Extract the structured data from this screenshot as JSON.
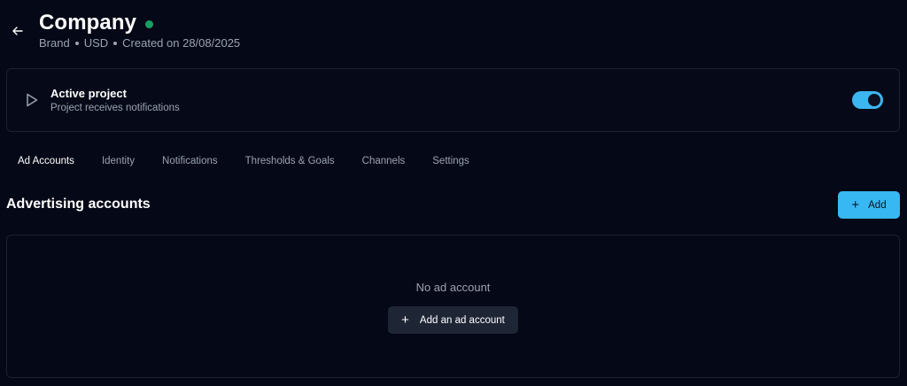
{
  "header": {
    "title": "Company",
    "meta": {
      "type": "Brand",
      "currency": "USD",
      "created": "Created on 28/08/2025"
    }
  },
  "project": {
    "title": "Active project",
    "subtitle": "Project receives notifications",
    "toggle_on": true
  },
  "tabs": [
    {
      "label": "Ad Accounts",
      "active": true
    },
    {
      "label": "Identity",
      "active": false
    },
    {
      "label": "Notifications",
      "active": false
    },
    {
      "label": "Thresholds & Goals",
      "active": false
    },
    {
      "label": "Channels",
      "active": false
    },
    {
      "label": "Settings",
      "active": false
    }
  ],
  "section": {
    "title": "Advertising accounts",
    "add_label": "Add"
  },
  "empty_state": {
    "message": "No ad account",
    "button_label": "Add an ad account"
  },
  "colors": {
    "background": "#050816",
    "accent": "#38b8f2",
    "status_dot": "#16a065"
  },
  "icons": {
    "back": "arrow-left-icon",
    "play": "play-icon",
    "plus": "plus-icon"
  }
}
